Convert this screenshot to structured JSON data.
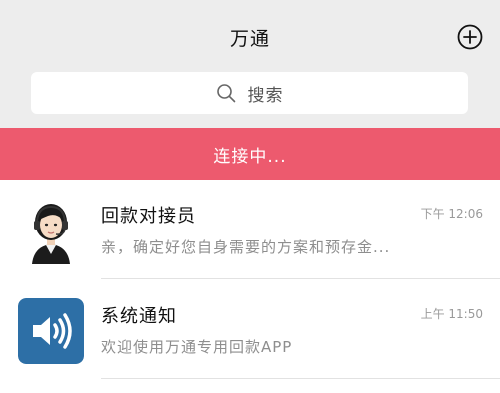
{
  "header": {
    "title": "万通",
    "add_icon": "plus-circle-icon"
  },
  "search": {
    "placeholder": "搜索",
    "icon": "search-icon"
  },
  "status_banner": {
    "text": "连接中...",
    "color": "#ed5a6e"
  },
  "chats": [
    {
      "name": "回款对接员",
      "time": "下午 12:06",
      "preview": "亲，确定好您自身需要的方案和预存金...",
      "avatar": "agent-avatar-icon"
    },
    {
      "name": "系统通知",
      "time": "上午 11:50",
      "preview": "欢迎使用万通专用回款APP",
      "avatar": "speaker-icon",
      "avatar_color": "#2d6fa6"
    }
  ]
}
